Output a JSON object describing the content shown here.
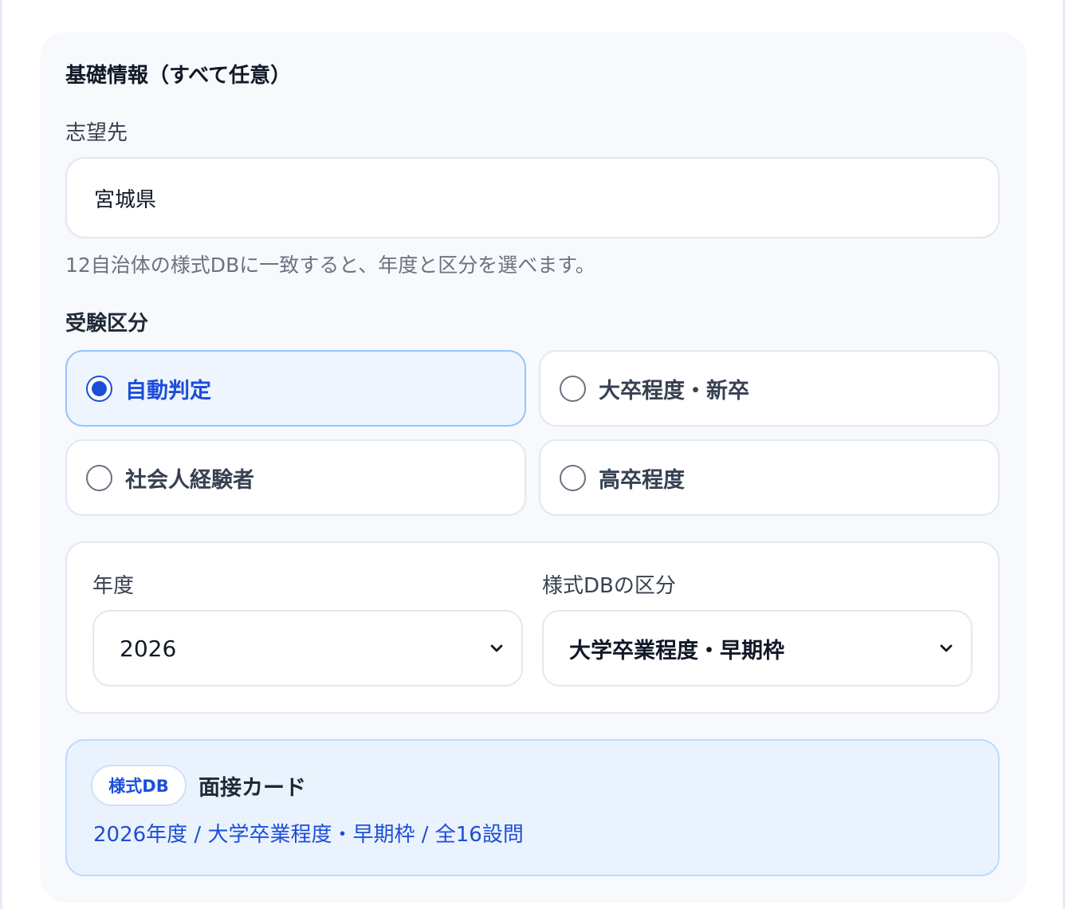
{
  "section": {
    "title": "基礎情報（すべて任意）"
  },
  "destination": {
    "label": "志望先",
    "value": "宮城県",
    "help": "12自治体の様式DBに一致すると、年度と区分を選べます。"
  },
  "exam_category": {
    "label": "受験区分",
    "options": [
      {
        "label": "自動判定",
        "selected": true
      },
      {
        "label": "大卒程度・新卒",
        "selected": false
      },
      {
        "label": "社会人経験者",
        "selected": false
      },
      {
        "label": "高卒程度",
        "selected": false
      }
    ]
  },
  "year_select": {
    "label": "年度",
    "value": "2026"
  },
  "db_category_select": {
    "label": "様式DBの区分",
    "value": "大学卒業程度・早期枠"
  },
  "result": {
    "badge": "様式DB",
    "title": "面接カード",
    "meta": "2026年度 / 大学卒業程度・早期枠 / 全16設問"
  },
  "colors": {
    "accent": "#1d4ed8",
    "panel_bg": "#f7f9fc",
    "selected_bg": "#eef5fe",
    "result_bg": "#eaf3fd"
  }
}
